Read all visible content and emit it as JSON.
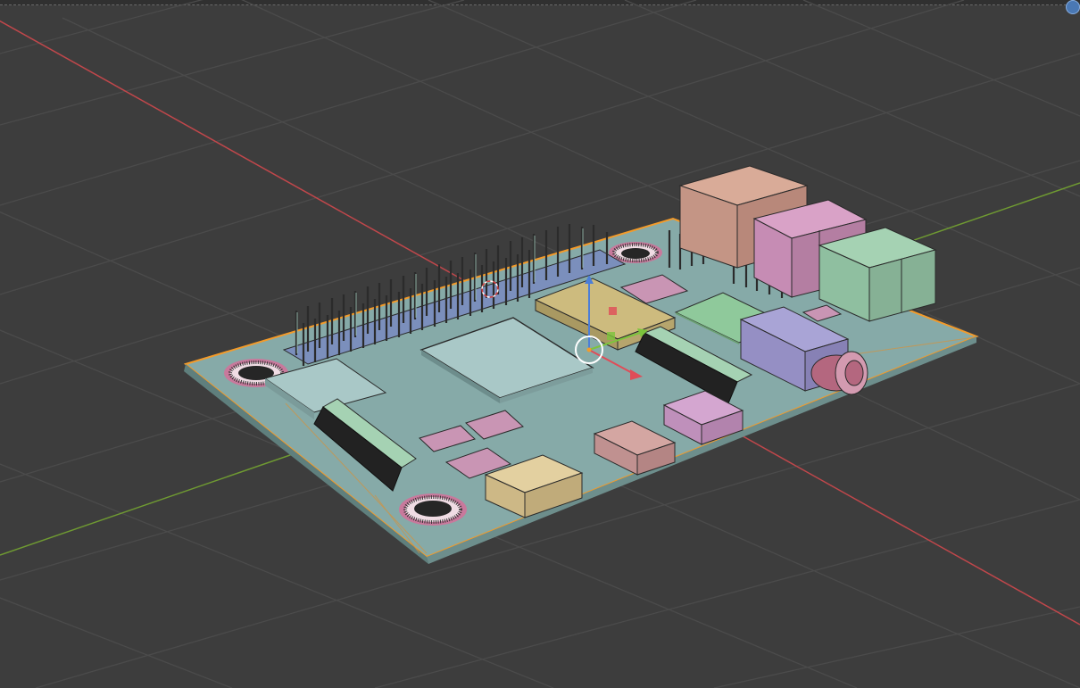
{
  "app": {
    "name": "3D viewport"
  },
  "viewport": {
    "background_color": "#3d3d3d",
    "grid_color": "#4b4b4b",
    "x_axis_color": "#c0474b",
    "y_axis_color": "#6f9a32",
    "selection_outline_color": "#f39b2a"
  },
  "scene": {
    "selected_object": "pcb-board",
    "components": [
      "pcb-board",
      "gpio-header",
      "processor-chip",
      "memory-chip",
      "ethernet-port",
      "usb-port-pink",
      "usb-port-green",
      "audio-jack",
      "hdmi-port",
      "micro-usb-ports",
      "ribbon-connectors",
      "mounting-holes"
    ]
  }
}
